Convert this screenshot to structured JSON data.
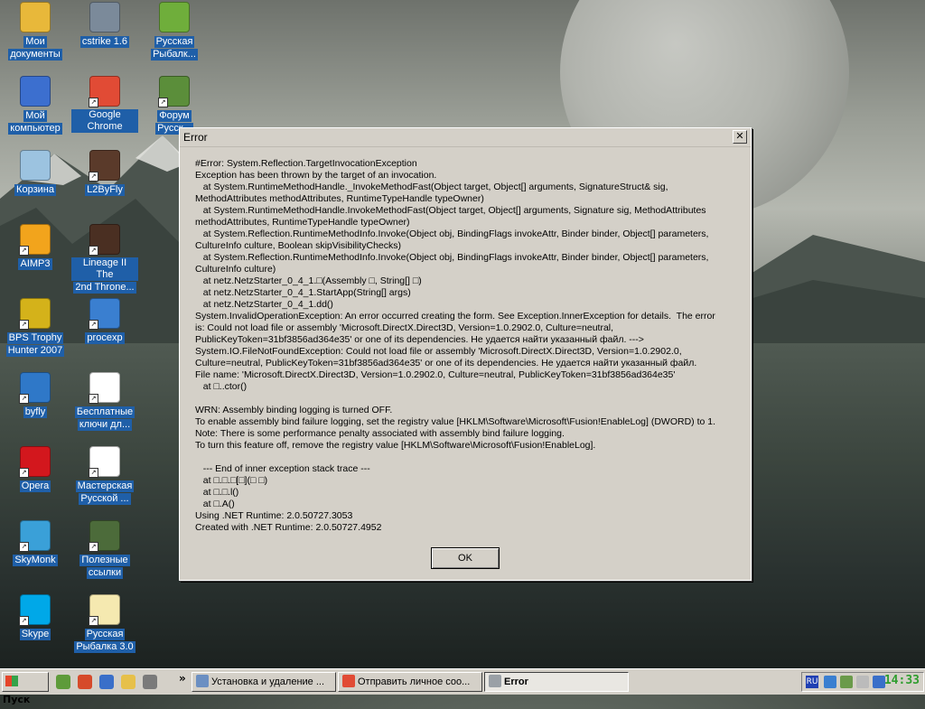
{
  "desktop": {
    "icons": [
      {
        "label": "Мои документы",
        "label_l1": "Мои",
        "label_l2": "документы",
        "color": "#e8b83a"
      },
      {
        "label": "cstrike 1.6",
        "color": "#7b8a9a"
      },
      {
        "label": "Русская Рыбалк...",
        "label_l1": "Русская",
        "label_l2": "Рыбалк...",
        "color": "#6fae3b"
      },
      {
        "label": "Мой компьютер",
        "label_l1": "Мой",
        "label_l2": "компьютер",
        "color": "#3c6fcf"
      },
      {
        "label": "Google Chrome",
        "color": "#e14b35"
      },
      {
        "label": "Форум Русск...",
        "label_l1": "Форум",
        "label_l2": "Русск...",
        "color": "#5b8e3a"
      },
      {
        "label": "Корзина",
        "color": "#9cc3e0"
      },
      {
        "label": "L2ByFly",
        "color": "#5a3a2a"
      },
      {
        "label": "AIMP3",
        "color": "#f2a41c"
      },
      {
        "label": "Lineage II The 2nd Throne...",
        "label_l1": "Lineage II The",
        "label_l2": "2nd Throne...",
        "color": "#4a2f22"
      },
      {
        "label": "BPS Trophy Hunter 2007",
        "label_l1": "BPS Trophy",
        "label_l2": "Hunter 2007",
        "color": "#d4b21a"
      },
      {
        "label": "procexp",
        "color": "#3a7fd0"
      },
      {
        "label": "byfly",
        "color": "#2f78c8"
      },
      {
        "label": "Бесплатные ключи дл...",
        "label_l1": "Бесплатные",
        "label_l2": "ключи дл...",
        "color": "#ffffff"
      },
      {
        "label": "Opera",
        "color": "#d3171d"
      },
      {
        "label": "Мастерская Русской ...",
        "label_l1": "Мастерская",
        "label_l2": "Русской ...",
        "color": "#ffffff"
      },
      {
        "label": "SkyMonk",
        "color": "#3aa0d8"
      },
      {
        "label": "Полезные ссылки",
        "label_l1": "Полезные",
        "label_l2": "ссылки",
        "color": "#4c6b3a"
      },
      {
        "label": "Skype",
        "color": "#00a8e8"
      },
      {
        "label": "Русская Рыбалка 3.0",
        "label_l1": "Русская",
        "label_l2": "Рыбалка 3.0",
        "color": "#f5e9b0"
      }
    ]
  },
  "dialog": {
    "title": "Error",
    "close_glyph": "✕",
    "ok_label": "OK",
    "lines": [
      "#Error: System.Reflection.TargetInvocationException",
      "Exception has been thrown by the target of an invocation.",
      "   at System.RuntimeMethodHandle._InvokeMethodFast(Object target, Object[] arguments, SignatureStruct& sig,",
      "MethodAttributes methodAttributes, RuntimeTypeHandle typeOwner)",
      "   at System.RuntimeMethodHandle.InvokeMethodFast(Object target, Object[] arguments, Signature sig, MethodAttributes",
      "methodAttributes, RuntimeTypeHandle typeOwner)",
      "   at System.Reflection.RuntimeMethodInfo.Invoke(Object obj, BindingFlags invokeAttr, Binder binder, Object[] parameters,",
      "CultureInfo culture, Boolean skipVisibilityChecks)",
      "   at System.Reflection.RuntimeMethodInfo.Invoke(Object obj, BindingFlags invokeAttr, Binder binder, Object[] parameters,",
      "CultureInfo culture)",
      "   at netz.NetzStarter_0_4_1.□(Assembly □, String[] □)",
      "   at netz.NetzStarter_0_4_1.StartApp(String[] args)",
      "   at netz.NetzStarter_0_4_1.dd()",
      "System.InvalidOperationException: An error occurred creating the form. See Exception.InnerException for details.  The error",
      "is: Could not load file or assembly 'Microsoft.DirectX.Direct3D, Version=1.0.2902.0, Culture=neutral,",
      "PublicKeyToken=31bf3856ad364e35' or one of its dependencies. Не удается найти указанный файл. --->",
      "System.IO.FileNotFoundException: Could not load file or assembly 'Microsoft.DirectX.Direct3D, Version=1.0.2902.0,",
      "Culture=neutral, PublicKeyToken=31bf3856ad364e35' or one of its dependencies. Не удается найти указанный файл.",
      "File name: 'Microsoft.DirectX.Direct3D, Version=1.0.2902.0, Culture=neutral, PublicKeyToken=31bf3856ad364e35'",
      "   at □..ctor()",
      "",
      "WRN: Assembly binding logging is turned OFF.",
      "To enable assembly bind failure logging, set the registry value [HKLM\\Software\\Microsoft\\Fusion!EnableLog] (DWORD) to 1.",
      "Note: There is some performance penalty associated with assembly bind failure logging.",
      "To turn this feature off, remove the registry value [HKLM\\Software\\Microsoft\\Fusion!EnableLog].",
      "",
      "   --- End of inner exception stack trace ---",
      "   at □.□.□[□](□ □)",
      "   at □.□.l()",
      "   at □.A()",
      "Using .NET Runtime: 2.0.50727.3053",
      "Created with .NET Runtime: 2.0.50727.4952"
    ]
  },
  "taskbar": {
    "start_label": "Пуск",
    "chevron": "»",
    "quicklaunch_colors": [
      "#5e9b3a",
      "#d64a2a",
      "#3a6fc9",
      "#e6c04a",
      "#7a7a7a"
    ],
    "tasks": [
      {
        "label": "Установка и удаление ...",
        "color": "#6b8fc2",
        "active": false
      },
      {
        "label": "Отправить личное соо...",
        "color": "#e14b35",
        "active": false
      },
      {
        "label": "Error",
        "color": "#9aa0a6",
        "active": true
      }
    ],
    "tray": {
      "lang": "RU",
      "icon_colors": [
        "#3a7fd0",
        "#6a9a4a",
        "#bbbbbb",
        "#3a6fc9"
      ],
      "clock": "14:33"
    }
  }
}
